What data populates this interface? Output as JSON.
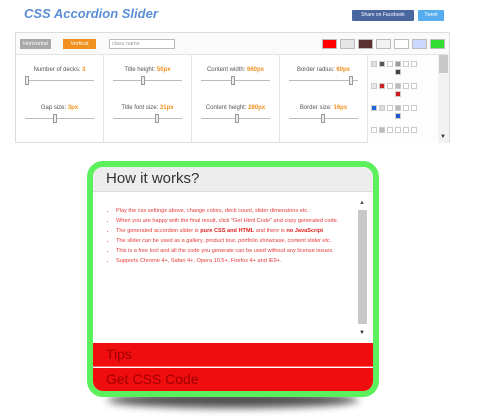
{
  "header": {
    "title": "CSS Accordion Slider",
    "share_facebook": "Share on Facebook",
    "tweet": "Tweet"
  },
  "toolbar": {
    "orientation_horizontal": "Horizontal",
    "orientation_vertical": "Vertical",
    "orientation_selected": "Vertical",
    "class_name_placeholder": "class name",
    "swatches": [
      "#ff0000",
      "#e6e6e6",
      "#5a3030",
      "#f2f2f2",
      "#ffffff",
      "#ffffff",
      "#33dd33"
    ]
  },
  "settings": {
    "number_of_decks": {
      "label": "Number of decks:",
      "value": "3"
    },
    "gap_size": {
      "label": "Gap size:",
      "value": "3px"
    },
    "title_height": {
      "label": "Title height:",
      "value": "50px"
    },
    "title_font_size": {
      "label": "Title font size:",
      "value": "31px"
    },
    "content_width": {
      "label": "Content width:",
      "value": "660px"
    },
    "content_height": {
      "label": "Content height:",
      "value": "280px"
    },
    "border_radius": {
      "label": "Border radius:",
      "value": "60px"
    },
    "border_size": {
      "label": "Border size:",
      "value": "16px"
    }
  },
  "palettes": [
    {
      "top": [
        "#e0e0e0",
        "#555555",
        "#ffffff",
        "#999999",
        "#ffffff",
        "#ffffff"
      ],
      "bottom": "#444444"
    },
    {
      "top": [
        "#e8e8e8",
        "#cc2222",
        "#ffffff",
        "#bbbbbb",
        "#ffffff",
        "#ffffff"
      ],
      "bottom": "#cc1a1a"
    },
    {
      "top": [
        "#2266dd",
        "#dddddd",
        "#ffffff",
        "#bbbbbb",
        "#ffffff",
        "#ffffff"
      ],
      "bottom": "#2255cc"
    },
    {
      "top": [
        "#ffffff",
        "#bbbbbb",
        "#ffffff",
        "#ffffff",
        "#ffffff",
        "#ffffff"
      ],
      "bottom": "#dddddd"
    }
  ],
  "accordion": {
    "panel_open_title": "How it works?",
    "items": [
      "Play the css settings above, change colors, deck count, slider dimensions etc.",
      "When you are happy with the final result, click \"Get Html Code\" and copy generated code.",
      "The generated accordion slider is ",
      "The slider can be used as a gallery, product tour, portfolio showcase, content slider etc.",
      "This is a free tool and all the code you generate can be used without any license issues.",
      "Supports Chrome 4+, Safari 4+, Opera 10.5+, Firefox 4+ and IE9+."
    ],
    "item3_bold1": "pure CSS and HTML",
    "item3_mid": " and there is ",
    "item3_bold2": "no JavaScript",
    "panel_tips_title": "Tips",
    "panel_code_title": "Get CSS Code"
  }
}
